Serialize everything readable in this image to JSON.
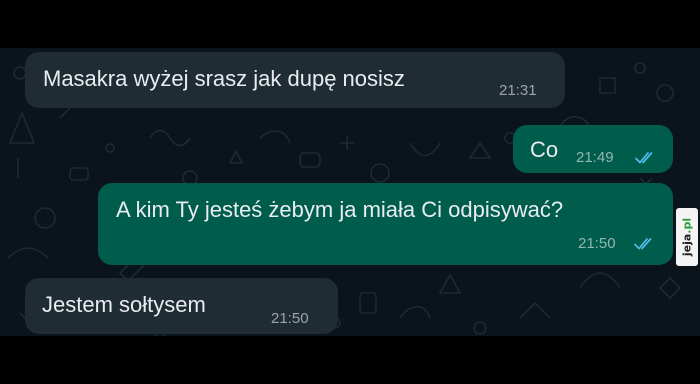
{
  "messages": [
    {
      "direction": "incoming",
      "text": "Masakra wyżej srasz jak dupę nosisz",
      "time": "21:31"
    },
    {
      "direction": "outgoing",
      "text": "Co",
      "time": "21:49",
      "status": "read"
    },
    {
      "direction": "outgoing",
      "text": "A kim Ty jesteś żebym ja miała Ci odpisywać?",
      "time": "21:50",
      "status": "read"
    },
    {
      "direction": "incoming",
      "text": "Jestem sołtysem",
      "time": "21:50"
    }
  ],
  "watermark": {
    "name": "jeja",
    "suffix": ".pl"
  },
  "colors": {
    "chat_background": "#0b141a",
    "incoming_bubble": "#1f2c34",
    "outgoing_bubble": "#005c4b",
    "read_ticks": "#53bdeb",
    "text": "#e9edef"
  },
  "icons": {
    "read_status": "double-check-icon"
  }
}
